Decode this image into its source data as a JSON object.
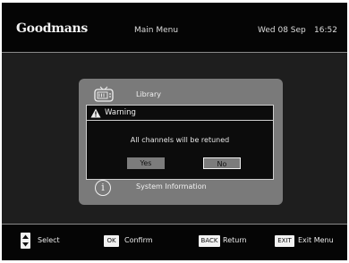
{
  "header": {
    "brand": "Goodmans",
    "title": "Main Menu",
    "date": "Wed 08 Sep",
    "time": "16:52"
  },
  "menu": {
    "items": [
      {
        "label": "Library",
        "icon": "tv-library-icon"
      },
      {
        "label": "System Information",
        "icon": "info-icon"
      }
    ]
  },
  "dialog": {
    "title": "Warning",
    "icon": "warning-icon",
    "message": "All channels will be retuned",
    "buttons": {
      "yes": "Yes",
      "no": "No"
    },
    "selected": "No"
  },
  "footer": {
    "select_label": "Select",
    "ok_key": "OK",
    "confirm_label": "Confirm",
    "back_key": "BACK",
    "return_label": "Return",
    "exit_key": "EXIT",
    "exit_label": "Exit Menu"
  },
  "colors": {
    "background": "#1e1e1e",
    "panel": "#7a7a7a",
    "dialog": "#0c0c0c",
    "key": "#f2f2f2"
  }
}
